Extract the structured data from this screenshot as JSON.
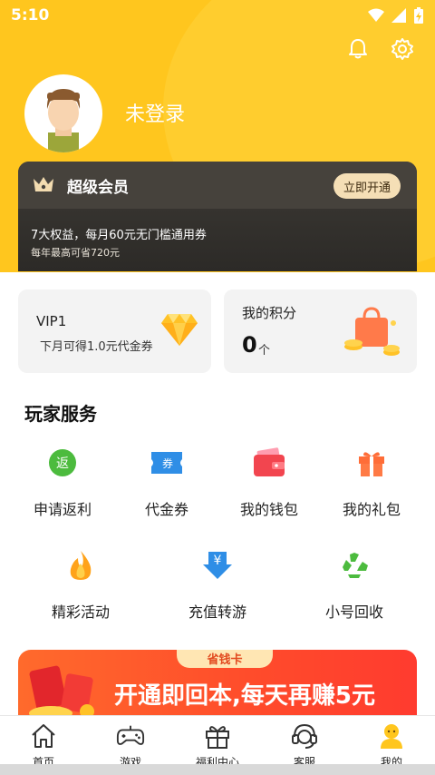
{
  "status_bar": {
    "time": "5:10"
  },
  "profile": {
    "login_text": "未登录"
  },
  "vip_banner": {
    "title": "超级会员",
    "open_button": "立即开通",
    "description": "7大权益，每月60元无门槛通用券",
    "savings": "每年最高可省720元"
  },
  "vip_card": {
    "level": "VIP1",
    "description": "下月可得1.0元代金券"
  },
  "points_card": {
    "title": "我的积分",
    "value": "0",
    "unit": "个"
  },
  "services": {
    "title": "玩家服务",
    "items": [
      {
        "label": "申请返利",
        "icon_text": "返"
      },
      {
        "label": "代金券",
        "icon_text": "券"
      },
      {
        "label": "我的钱包"
      },
      {
        "label": "我的礼包"
      },
      {
        "label": "精彩活动"
      },
      {
        "label": "充值转游",
        "icon_text": "¥"
      },
      {
        "label": "小号回收"
      }
    ]
  },
  "promo_banner": {
    "tag": "省钱卡",
    "headline": "开通即回本,每天再赚5元"
  },
  "tabbar": {
    "items": [
      {
        "label": "首页"
      },
      {
        "label": "游戏"
      },
      {
        "label": "福利中心"
      },
      {
        "label": "客服"
      },
      {
        "label": "我的"
      }
    ]
  },
  "colors": {
    "brand_yellow": "#ffc61e",
    "vip_dark": "#3d3a35",
    "promo_red": "#ff4b2b",
    "rebate_green": "#4cbb3e",
    "coupon_blue": "#2f8ee6"
  }
}
